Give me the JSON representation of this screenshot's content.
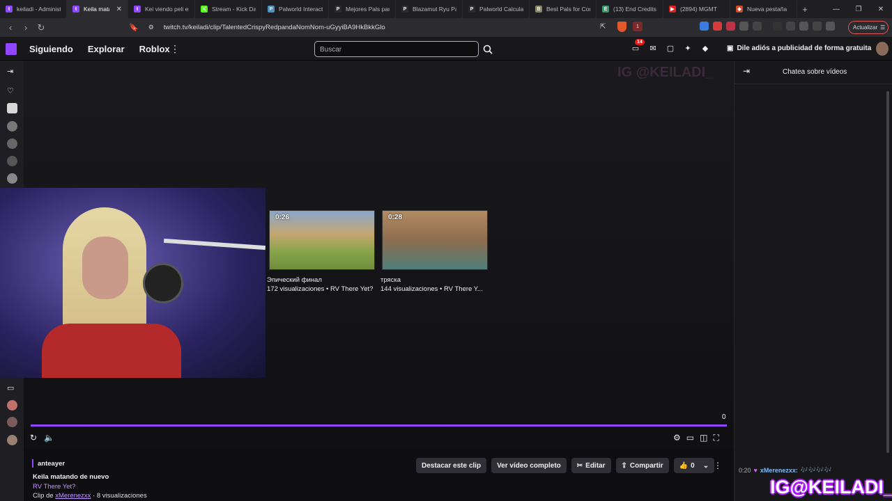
{
  "browser": {
    "tabs": [
      {
        "label": "keiladi - Administ",
        "color": "#9147ff",
        "glyph": "t"
      },
      {
        "label": "Keila matando",
        "color": "#9147ff",
        "glyph": "t",
        "active": true
      },
      {
        "label": "Kei viendo peli es",
        "color": "#9147ff",
        "glyph": "t"
      },
      {
        "label": "Stream - Kick Das",
        "color": "#53fc18",
        "glyph": "K"
      },
      {
        "label": "Palworld Interacti",
        "color": "#4a90c0",
        "glyph": "P"
      },
      {
        "label": "Mejores Pals para",
        "color": "#2b2b30",
        "glyph": "P"
      },
      {
        "label": "Blazamut Ryu Pal",
        "color": "#2b2b30",
        "glyph": "P"
      },
      {
        "label": "Palworld Calculat",
        "color": "#2b2b30",
        "glyph": "P"
      },
      {
        "label": "Best Pals for Com",
        "color": "#888866",
        "glyph": "B"
      },
      {
        "label": "(13) End Credits /",
        "color": "#3a9a6a",
        "glyph": "E"
      },
      {
        "label": "(2894) MGMT",
        "color": "#e02020",
        "glyph": "▶"
      },
      {
        "label": "Nueva pestaña",
        "color": "#d04a2a",
        "glyph": "◆"
      }
    ],
    "url": "twitch.tv/keiladi/clip/TalentedCrispyRedpandaNomNom-uGyyiBA9HkBkkGlo",
    "update_label": "Actualizar",
    "brave_count": "1"
  },
  "twitch": {
    "nav": [
      "Siguiendo",
      "Explorar",
      "Roblox"
    ],
    "search_placeholder": "Buscar",
    "notif_badge": "14",
    "turbo_label": "Dile adiós a publicidad de forma gratuita"
  },
  "player": {
    "recommended": [
      {
        "duration": "0:26",
        "title": "Эпический финал",
        "meta": "172 visualizaciones • RV There Yet?"
      },
      {
        "duration": "0:28",
        "title": "тряска",
        "meta": "144 visualizaciones • RV There Y..."
      }
    ],
    "counter": "0",
    "bg_text": "IG @KEILADI_"
  },
  "clip": {
    "author": "anteayer",
    "title": "Keila matando de nuevo",
    "game": "RV There Yet?",
    "clip_prefix": "Clip de",
    "clipper": "xMerenezxx",
    "views": "· 8 visualizaciones",
    "actions": {
      "highlight": "Destacar este clip",
      "full_video": "Ver vídeo completo",
      "edit": "Editar",
      "share": "Compartir",
      "likes": "0"
    }
  },
  "chat": {
    "title": "Chatea sobre vídeos",
    "message": {
      "time": "0:20",
      "user": "xMerenezxx:",
      "text": "🎶🎶🎶🎶"
    },
    "overlay_text": "IG@KEILADI_"
  }
}
